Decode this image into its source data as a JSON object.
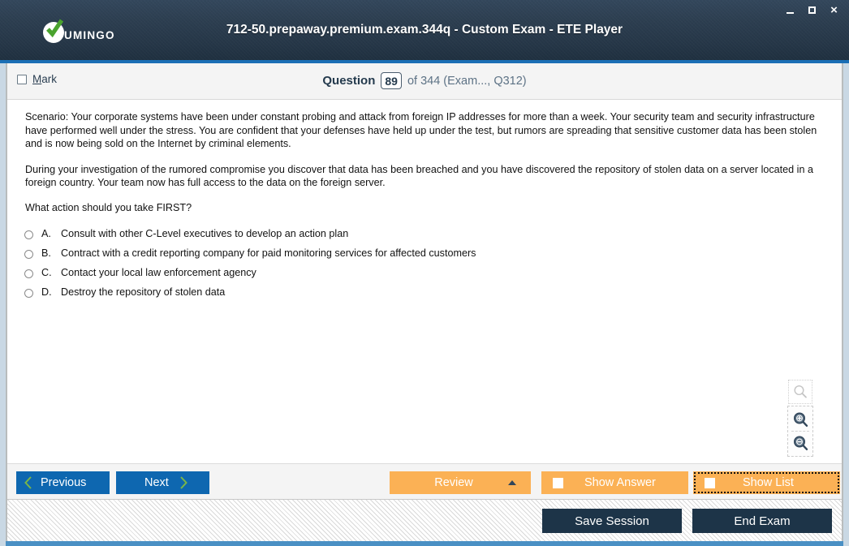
{
  "window": {
    "title": "712-50.prepaway.premium.exam.344q - Custom Exam - ETE Player",
    "logo_text": "UMINGO",
    "controls": {
      "minimize": "minimize-icon",
      "maximize": "maximize-icon",
      "close": "×"
    }
  },
  "qheader": {
    "mark_accel": "M",
    "mark_rest": "ark",
    "question_word": "Question",
    "question_number": "89",
    "rest": "of 344 (Exam..., Q312)"
  },
  "question": {
    "paragraphs": [
      "Scenario: Your corporate systems have been under constant probing and attack from foreign IP addresses for more than a week. Your security team and security infrastructure have performed well under the stress. You are confident that your defenses have held up under the test, but rumors are spreading that sensitive customer data has been stolen and is now being sold on the Internet by criminal elements.",
      "During your investigation of the rumored compromise you discover that data has been breached and you have discovered the repository of stolen data on a server located in a foreign country. Your team now has full access to the data on the foreign server."
    ],
    "prompt": "What action should you take FIRST?",
    "options": [
      {
        "letter": "A.",
        "text": "Consult with other C-Level executives to develop an action plan",
        "selected": false
      },
      {
        "letter": "B.",
        "text": "Contract with a credit reporting company for paid monitoring services for affected customers",
        "selected": false
      },
      {
        "letter": "C.",
        "text": "Contact your local law enforcement agency",
        "selected": false
      },
      {
        "letter": "D.",
        "text": "Destroy the repository of stolen data",
        "selected": false
      }
    ]
  },
  "zoom_tools": {
    "plain": "magnifier-icon",
    "zoom_in": "zoom-in-icon",
    "zoom_out": "zoom-out-icon"
  },
  "toolbar": {
    "previous_label": "Previous",
    "next_label": "Next",
    "review_label": "Review",
    "show_answer_label": "Show Answer",
    "show_list_label": "Show List"
  },
  "footer": {
    "save_session_label": "Save Session",
    "end_exam_label": "End Exam"
  },
  "colors": {
    "titlebar": "#2c3e50",
    "accent_blue": "#1b6fb5",
    "button_blue": "#0e67b0",
    "button_orange": "#fbb155",
    "button_dark": "#1d3448",
    "chevron_green": "#7ab648",
    "footer_bar": "#4a90c4"
  }
}
